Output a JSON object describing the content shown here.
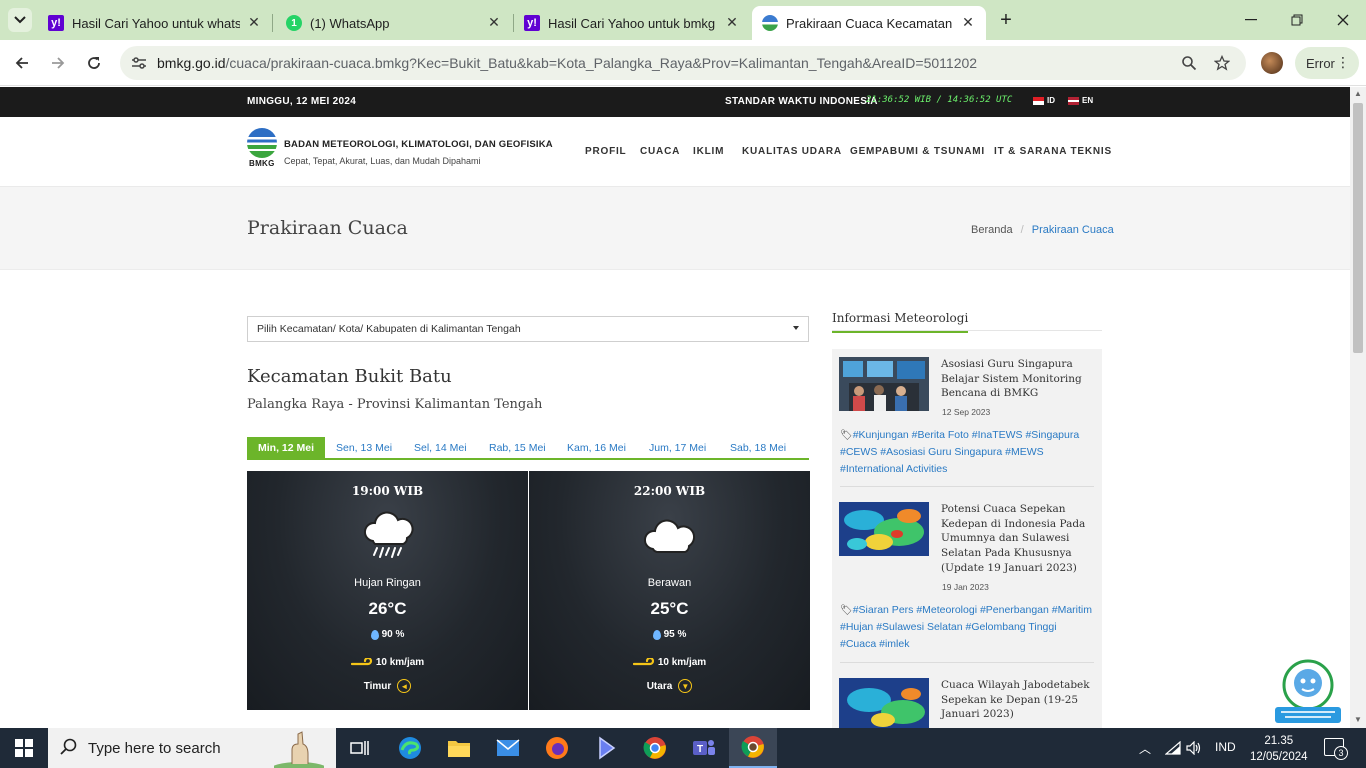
{
  "tabs": [
    {
      "title": "Hasil Cari Yahoo untuk whatsapp",
      "favicon": "yahoo-icon"
    },
    {
      "title": "(1) WhatsApp",
      "favicon": "whatsapp-icon"
    },
    {
      "title": "Hasil Cari Yahoo untuk bmkg pa",
      "favicon": "yahoo-icon"
    },
    {
      "title": "Prakiraan Cuaca Kecamatan Buk",
      "favicon": "bmkg-icon",
      "active": true
    }
  ],
  "address": {
    "host": "bmkg.go.id",
    "path": "/cuaca/prakiraan-cuaca.bmkg?Kec=Bukit_Batu&kab=Kota_Palangka_Raya&Prov=Kalimantan_Tengah&AreaID=5011202"
  },
  "profile": {
    "error_label": "Error"
  },
  "topbar": {
    "date": "MINGGU, 12 MEI 2024",
    "std_label": "STANDAR WAKTU INDONESIA",
    "clock": "21:36:52 WIB / 14:36:52 UTC",
    "lang_id": "ID",
    "lang_en": "EN"
  },
  "header": {
    "logo_text": "BMKG",
    "org_name": "BADAN METEOROLOGI, KLIMATOLOGI, DAN GEOFISIKA",
    "tagline": "Cepat, Tepat, Akurat, Luas, dan Mudah Dipahami",
    "nav": [
      "PROFIL",
      "CUACA",
      "IKLIM",
      "KUALITAS UDARA",
      "GEMPABUMI & TSUNAMI",
      "IT & SARANA TEKNIS"
    ]
  },
  "page": {
    "title": "Prakiraan Cuaca",
    "breadcrumb_home": "Beranda",
    "breadcrumb_current": "Prakiraan Cuaca"
  },
  "main": {
    "select_placeholder": "Pilih Kecamatan/ Kota/ Kabupaten di Kalimantan Tengah",
    "location_title": "Kecamatan Bukit Batu",
    "location_sub": "Palangka Raya - Provinsi Kalimantan Tengah",
    "day_tabs": [
      "Min, 12 Mei",
      "Sen, 13 Mei",
      "Sel, 14 Mei",
      "Rab, 15 Mei",
      "Kam, 16 Mei",
      "Jum, 17 Mei",
      "Sab, 18 Mei"
    ],
    "forecasts": [
      {
        "time": "19:00 WIB",
        "condition": "Hujan Ringan",
        "icon": "rain-cloud-icon",
        "temp": "26°C",
        "humidity": "90 %",
        "wind": "10 km/jam",
        "direction": "Timur"
      },
      {
        "time": "22:00 WIB",
        "condition": "Berawan",
        "icon": "cloud-icon",
        "temp": "25°C",
        "humidity": "95 %",
        "wind": "10 km/jam",
        "direction": "Utara"
      }
    ]
  },
  "sidebar": {
    "title": "Informasi Meteorologi",
    "news": [
      {
        "title": "Asosiasi Guru Singapura Belajar Sistem Monitoring Bencana di BMKG",
        "date": "12 Sep 2023",
        "tags": "#Kunjungan #Berita Foto #InaTEWS #Singapura #CEWS #Asosiasi Guru Singapura #MEWS #International Activities"
      },
      {
        "title": "Potensi Cuaca Sepekan Kedepan di Indonesia Pada Umumnya dan Sulawesi Selatan Pada Khususnya (Update 19 Januari 2023)",
        "date": "19 Jan 2023",
        "tags": "#Siaran Pers #Meteorologi #Penerbangan #Maritim #Hujan #Sulawesi Selatan #Gelombang Tinggi #Cuaca #imlek"
      },
      {
        "title": "Cuaca Wilayah Jabodetabek Sepekan ke Depan (19-25 Januari 2023)",
        "date": "",
        "tags": ""
      }
    ]
  },
  "taskbar": {
    "search_placeholder": "Type here to search",
    "lang": "IND",
    "time": "21.35",
    "date": "12/05/2024",
    "notifications": "3"
  },
  "colors": {
    "accent_green": "#6cb52a",
    "link_blue": "#2a7ac4",
    "tabstrip": "#cfe6c4"
  }
}
